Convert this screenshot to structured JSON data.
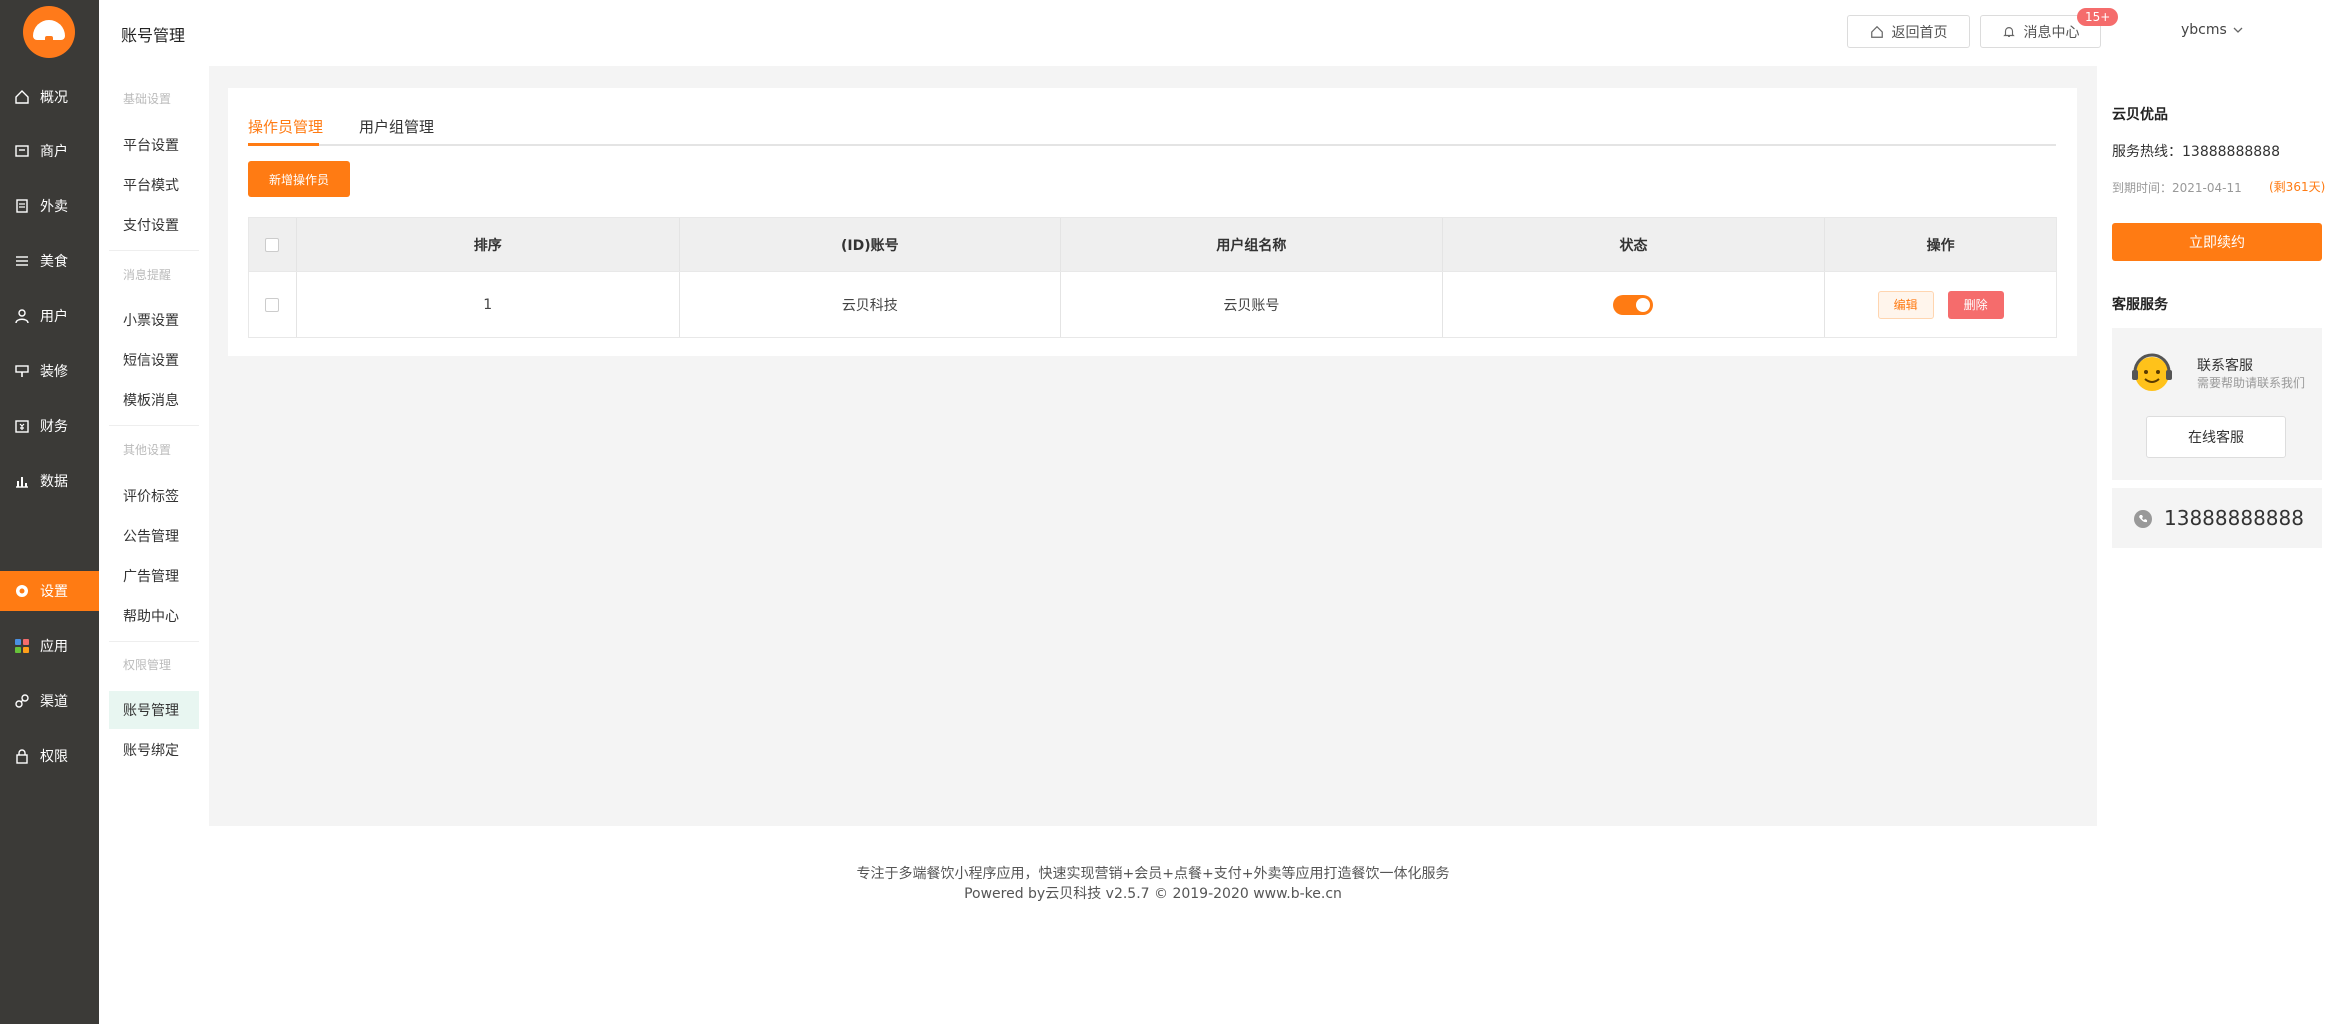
{
  "nav": {
    "items": [
      {
        "label": "概况",
        "icon": "home-icon"
      },
      {
        "label": "商户",
        "icon": "merchant-icon"
      },
      {
        "label": "外卖",
        "icon": "takeout-icon"
      },
      {
        "label": "美食",
        "icon": "menu-icon"
      },
      {
        "label": "用户",
        "icon": "user-icon"
      },
      {
        "label": "装修",
        "icon": "decorate-icon"
      },
      {
        "label": "财务",
        "icon": "finance-icon"
      },
      {
        "label": "数据",
        "icon": "chart-icon"
      },
      {
        "label": "设置",
        "icon": "gear-icon"
      },
      {
        "label": "应用",
        "icon": "apps-icon"
      },
      {
        "label": "渠道",
        "icon": "link-icon"
      },
      {
        "label": "权限",
        "icon": "lock-icon"
      }
    ],
    "active": "设置",
    "accent_color": "#ff7b13"
  },
  "subnav": {
    "title": "账号管理",
    "groups": {
      "basic": "基础设置",
      "message": "消息提醒",
      "other": "其他设置",
      "permission": "权限管理"
    },
    "items": {
      "platform_settings": "平台设置",
      "platform_mode": "平台模式",
      "payment_settings": "支付设置",
      "receipt_settings": "小票设置",
      "sms_settings": "短信设置",
      "template_message": "模板消息",
      "review_tags": "评价标签",
      "notice_management": "公告管理",
      "ad_management": "广告管理",
      "help_center": "帮助中心",
      "account_management": "账号管理",
      "account_binding": "账号绑定"
    }
  },
  "topbar": {
    "home_label": "返回首页",
    "messages_label": "消息中心",
    "messages_badge": "15+",
    "user_name": "ybcms"
  },
  "main": {
    "tabs": [
      "操作员管理",
      "用户组管理"
    ],
    "active_tab": "操作员管理",
    "add_button": "新增操作员",
    "table": {
      "headers": [
        "排序",
        "(ID)账号",
        "用户组名称",
        "状态",
        "操作"
      ],
      "rows": [
        {
          "order": "1",
          "account": "云贝科技",
          "group": "云贝账号",
          "status_on": true,
          "edit_label": "编辑",
          "delete_label": "删除"
        }
      ]
    }
  },
  "footer": {
    "line1": "专注于多端餐饮小程序应用，快速实现营销+会员+点餐+支付+外卖等应用打造餐饮一体化服务",
    "line2": "Powered by云贝科技 v2.5.7 © 2019-2020 www.b-ke.cn"
  },
  "right_panel": {
    "brand": "云贝优品",
    "hotline": "服务热线：13888888888",
    "expire_label": "到期时间：2021-04-11",
    "remaining": "(剩361天)",
    "renew_button": "立即续约",
    "service_title": "客服服务",
    "contact_label": "联系客服",
    "contact_help": "需要帮助请联系我们",
    "online_button": "在线客服",
    "phone": "13888888888"
  }
}
